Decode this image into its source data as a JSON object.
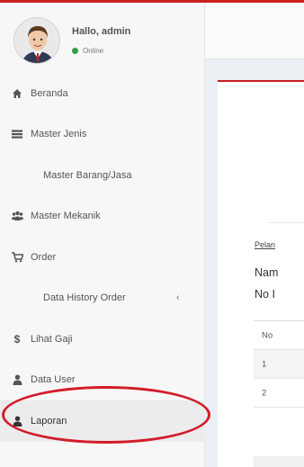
{
  "user": {
    "greeting": "Hallo, admin",
    "status": "Online",
    "status_color": "#2e9e4a"
  },
  "menu": [
    {
      "label": "Beranda",
      "icon": "home-icon"
    },
    {
      "label": "Master Jenis",
      "icon": "list-icon"
    },
    {
      "label": "Master Barang/Jasa",
      "icon": ""
    },
    {
      "label": "Master Mekanik",
      "icon": "users-icon"
    },
    {
      "label": "Order",
      "icon": "cart-icon"
    },
    {
      "label": "Data History Order",
      "icon": "",
      "chevron": "‹"
    },
    {
      "label": "Lihat Gaji",
      "icon": "dollar-icon"
    },
    {
      "label": "Data User",
      "icon": "user-icon"
    },
    {
      "label": "Laporan",
      "icon": "user-icon",
      "highlighted": true
    }
  ],
  "content": {
    "link_text": "Pelan",
    "info_line_1": "Nam",
    "info_line_2": "No I"
  },
  "table": {
    "header": "No",
    "rows": [
      "1",
      "2"
    ]
  },
  "colors": {
    "accent_red": "#cc2020",
    "highlight_ellipse": "#d31c2a",
    "sidebar_bg": "#f7f7f7"
  }
}
